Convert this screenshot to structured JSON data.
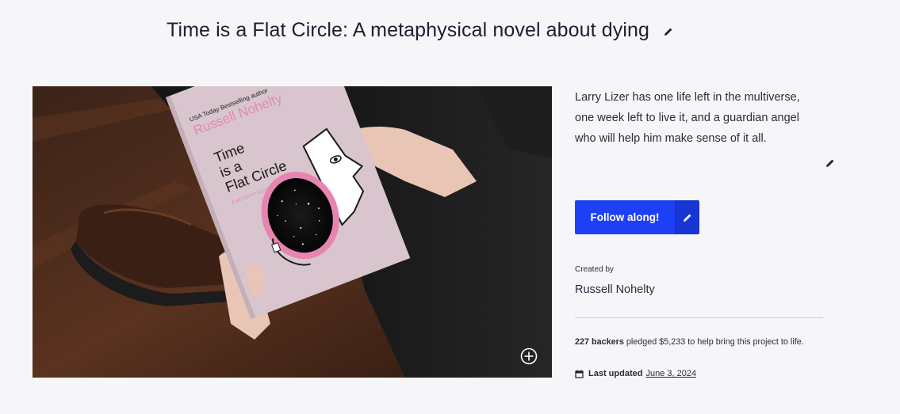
{
  "header": {
    "title": "Time is a Flat Circle: A metaphysical novel about dying"
  },
  "hero": {
    "book_cover": {
      "author_tag": "USA Today Bestselling author",
      "author": "Russell Nohelty",
      "title_line1": "Time",
      "title_line2": "is a",
      "title_line3": "Flat Circle",
      "subtitle": "A METAPHYSICAL NOVEL"
    },
    "expand_icon": "plus-circle-icon"
  },
  "description": {
    "text": "Larry Lizer has one life left in the multiverse, one week left to live it, and a guardian angel who will help him make sense of it all."
  },
  "follow": {
    "label": "Follow along!",
    "color": "#1e40f5"
  },
  "creator": {
    "label": "Created by",
    "name": "Russell Nohelty"
  },
  "stats": {
    "backers_count": "227 backers",
    "backers_rest": " pledged $5,233 to help bring this project to life."
  },
  "updated": {
    "label": "Last updated",
    "date": "June 3, 2024",
    "icon": "calendar-icon"
  }
}
